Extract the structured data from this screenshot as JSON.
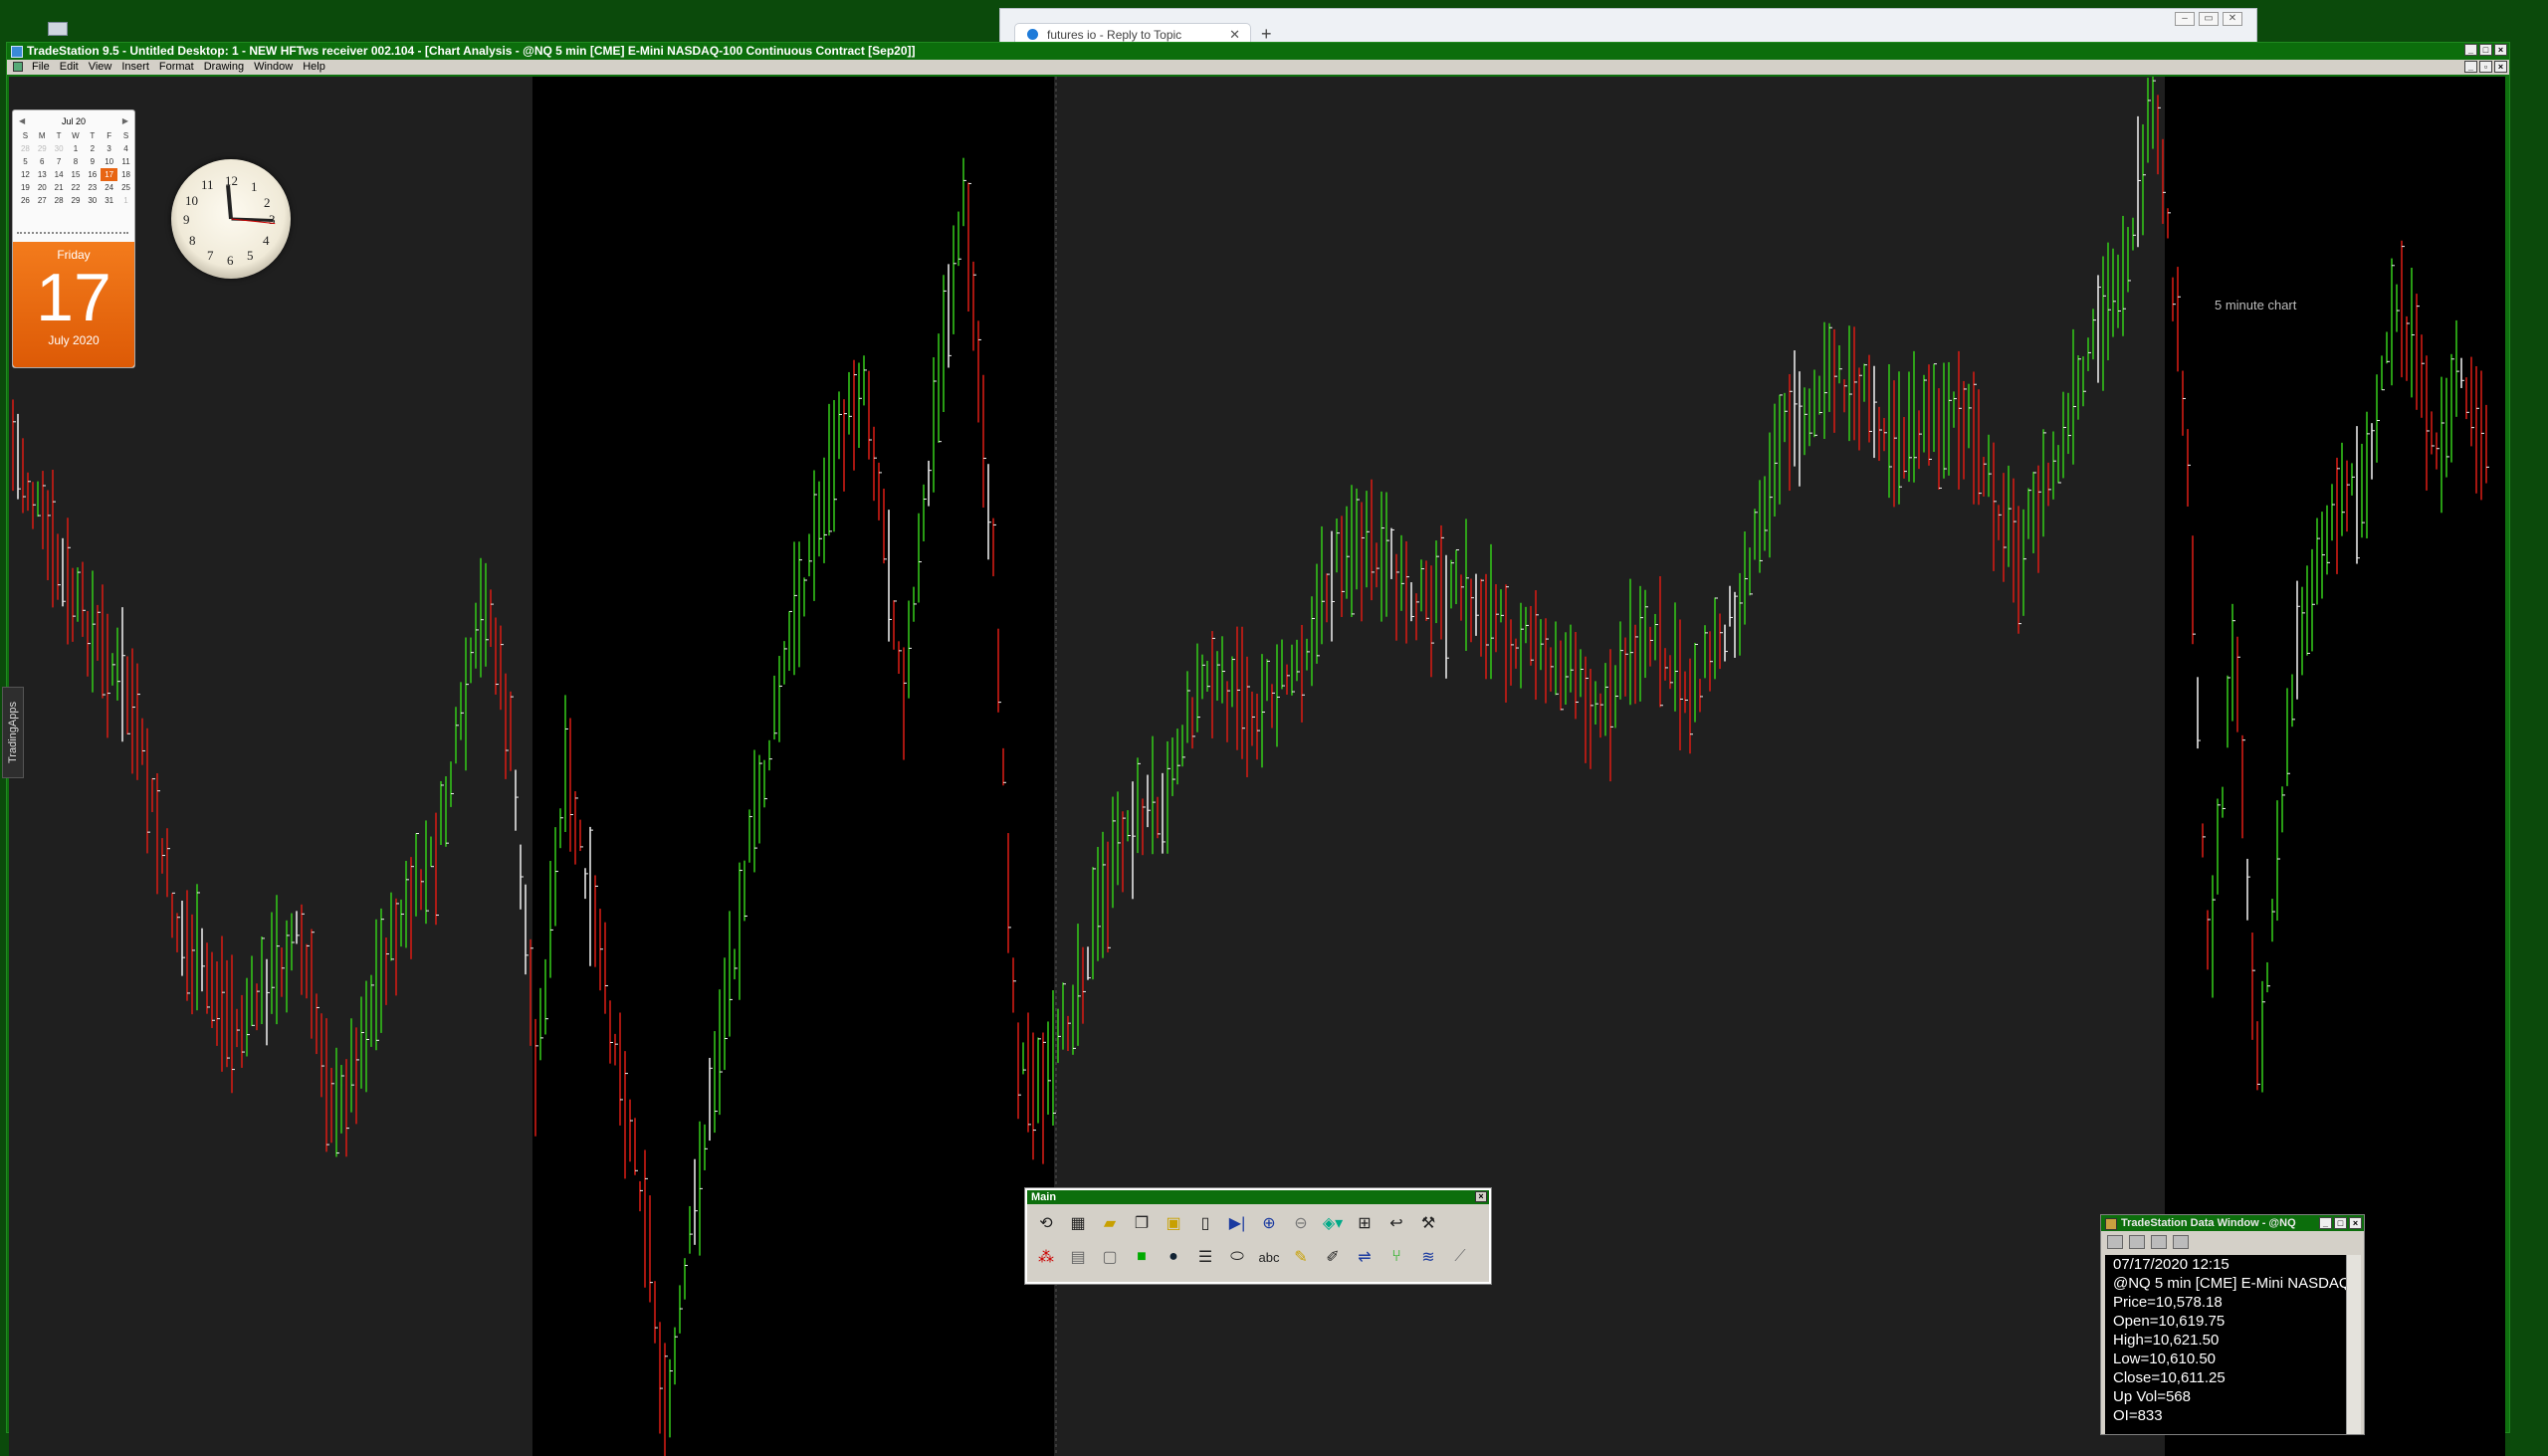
{
  "browser": {
    "tab_label": "futures io - Reply to Topic",
    "new_tab_symbol": "+"
  },
  "tradestation": {
    "title": "TradeStation 9.5 - Untitled Desktop: 1 - NEW HFTws receiver 002.104 - [Chart Analysis - @NQ 5 min [CME] E-Mini NASDAQ-100 Continuous Contract [Sep20]]",
    "menu": [
      "File",
      "Edit",
      "View",
      "Insert",
      "Format",
      "Drawing",
      "Window",
      "Help"
    ],
    "side_tab_label": "TradingApps",
    "chart_note": "5 minute chart",
    "colors": {
      "up_bar": "#33c21a",
      "down_bar": "#d01c14",
      "neutral_bar": "#e6e6e6",
      "session_dark": "#000000",
      "session_light": "#1f1f1f"
    }
  },
  "calendar": {
    "month_label": "Jul 20",
    "weekday_headers": [
      "S",
      "M",
      "T",
      "W",
      "T",
      "F",
      "S"
    ],
    "weeks": [
      [
        "28",
        "29",
        "30",
        "1",
        "2",
        "3",
        "4"
      ],
      [
        "5",
        "6",
        "7",
        "8",
        "9",
        "10",
        "11"
      ],
      [
        "12",
        "13",
        "14",
        "15",
        "16",
        "17",
        "18"
      ],
      [
        "19",
        "20",
        "21",
        "22",
        "23",
        "24",
        "25"
      ],
      [
        "26",
        "27",
        "28",
        "29",
        "30",
        "31",
        "1"
      ]
    ],
    "weekday": "Friday",
    "day": "17",
    "month_year": "July 2020"
  },
  "clock": {
    "numerals": [
      "12",
      "1",
      "2",
      "3",
      "4",
      "5",
      "6",
      "7",
      "8",
      "9",
      "10",
      "11"
    ]
  },
  "main_toolbar": {
    "title": "Main",
    "row1_icons": [
      "refresh-icon",
      "chart-window-icon",
      "open-folder-icon",
      "copy-icon",
      "paste-icon",
      "new-page-icon",
      "go-to-end-icon",
      "zoom-in-icon",
      "zoom-out-icon",
      "color-picker-icon",
      "layout-icon",
      "hook-icon",
      "tools-icon"
    ],
    "row2_icons": [
      "indicator-icon",
      "grid-icon",
      "window-icon",
      "stoplight-icon",
      "camera-icon",
      "lines-icon",
      "ellipse-icon",
      "text-tool-icon",
      "highlighter-icon",
      "pen-icon",
      "trendline-icon",
      "fork-icon",
      "wave-icon",
      "fib-icon"
    ],
    "row2_text_button": "abc"
  },
  "data_window": {
    "title": "TradeStation Data Window - @NQ",
    "lines": [
      "07/17/2020 12:15",
      "@NQ 5 min [CME] E-Mini NASDAQ",
      "Price=10,578.18",
      "Open=10,619.75",
      "High=10,621.50",
      "Low=10,610.50",
      "Close=10,611.25",
      "Up Vol=568",
      "OI=833"
    ]
  }
}
